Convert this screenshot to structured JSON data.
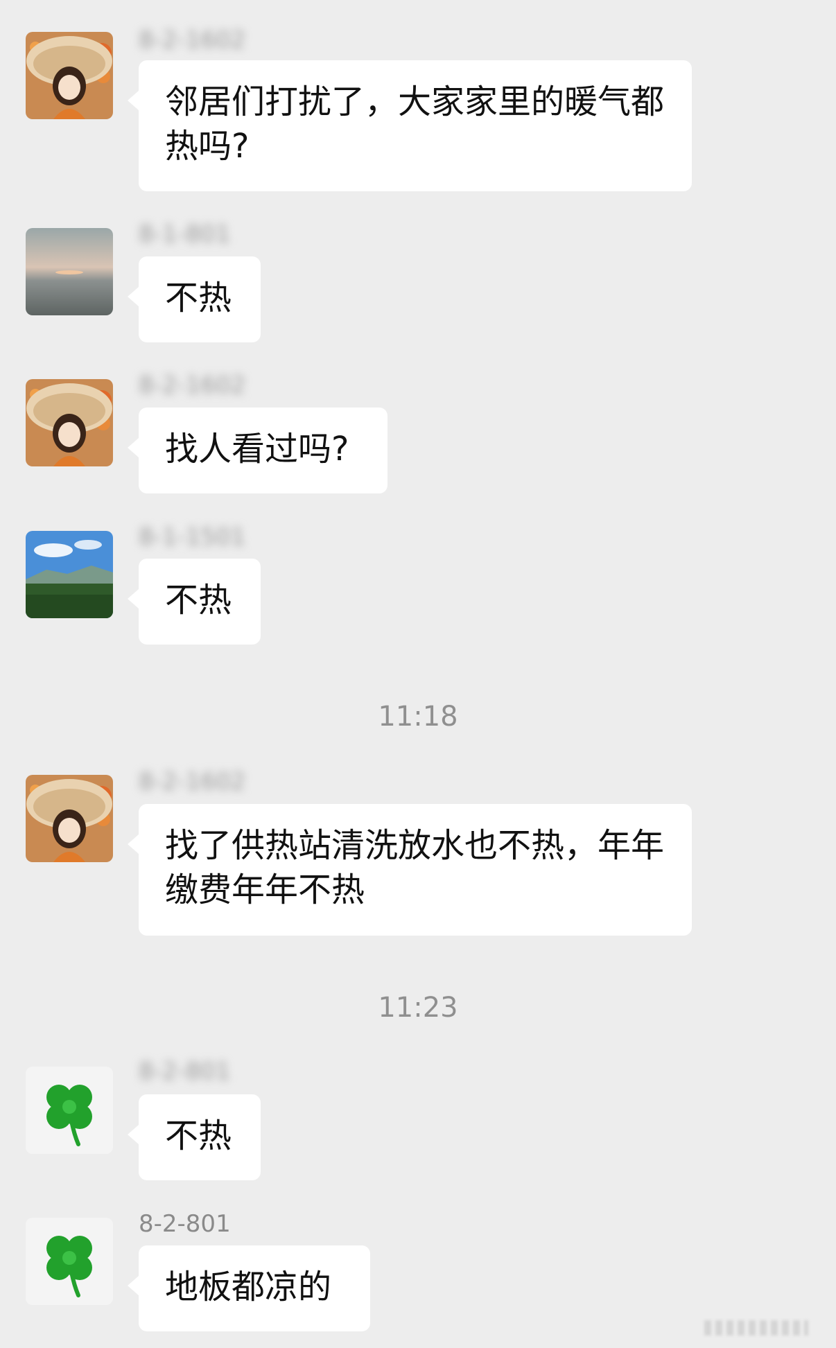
{
  "messages": [
    {
      "sender": "8-2-1602",
      "text": "邻居们打扰了，大家家里的暖气都热吗?",
      "avatar": "girl-with-hat-avatar"
    },
    {
      "sender": "8-1-801",
      "text": "不热",
      "avatar": "sunset-sea-avatar"
    },
    {
      "sender": "8-2-1602",
      "text": "找人看过吗?",
      "avatar": "girl-with-hat-avatar"
    },
    {
      "sender": "8-1-1501",
      "text": "不热",
      "avatar": "field-landscape-avatar"
    },
    {
      "sender": "8-2-1602",
      "text": "找了供热站清洗放水也不热，年年缴费年年不热",
      "avatar": "girl-with-hat-avatar"
    },
    {
      "sender": "8-2-801",
      "text": "不热",
      "avatar": "four-leaf-clover-avatar"
    },
    {
      "sender": "8-2-801",
      "text": "地板都凉的",
      "avatar": "four-leaf-clover-avatar"
    }
  ],
  "timestamps": [
    "11:18",
    "11:23"
  ],
  "colors": {
    "background": "#ededed",
    "bubble": "#ffffff",
    "text": "#111111",
    "meta_text": "#8a8a8a"
  }
}
